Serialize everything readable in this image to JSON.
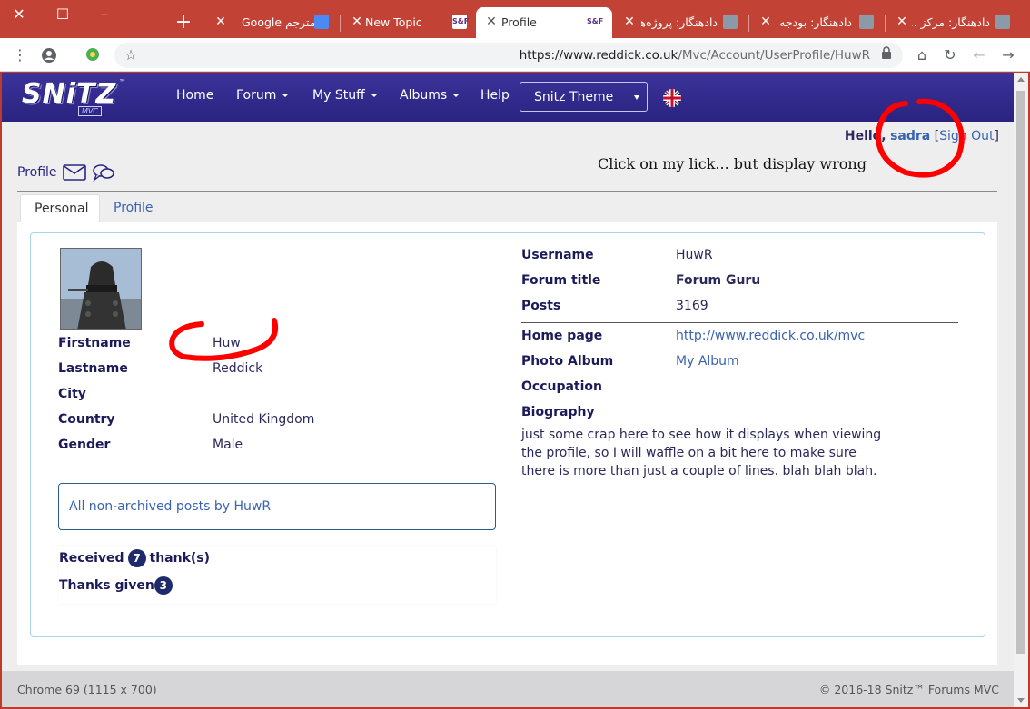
{
  "browser": {
    "tabs": [
      {
        "title": "دادهنگار: مرکز ...",
        "favicon": "snitz-favicon"
      },
      {
        "title": "دادهنگار: بودجه و...",
        "favicon": "snitz-favicon"
      },
      {
        "title": "دادهنگار: پروژه‌ها",
        "favicon": "snitz-favicon"
      },
      {
        "title": "Profile",
        "favicon": "snf-favicon"
      },
      {
        "title": "New Topic",
        "favicon": "snf-favicon"
      },
      {
        "title": "Google مترجم",
        "favicon": "google-translate-icon"
      }
    ],
    "url": {
      "host": "https://www.reddick.co.uk",
      "path": "/Mvc/Account/UserProfile/HuwR"
    }
  },
  "nav": {
    "logo_text": "SNiTZ",
    "logo_sub": "MVC",
    "logo_tm": "™",
    "home": "Home",
    "forum": "Forum",
    "my_stuff": "My Stuff",
    "albums": "Albums",
    "help": "Help",
    "theme": "Snitz Theme"
  },
  "greeting": {
    "hello": "Hello,",
    "user": "sadra",
    "sign_out": "Sign Out"
  },
  "page": {
    "profile_link": "Profile",
    "note": "Click on my lick... but display wrong",
    "tabs": {
      "personal": "Personal",
      "profile": "Profile"
    }
  },
  "personal": {
    "firstname_label": "Firstname",
    "firstname": "Huw",
    "lastname_label": "Lastname",
    "lastname": "Reddick",
    "city_label": "City",
    "city": "",
    "country_label": "Country",
    "country": "United Kingdom",
    "gender_label": "Gender",
    "gender": "Male",
    "posts_link": "All non-archived posts by HuwR",
    "received_label": "Received",
    "received_count": "7",
    "received_suffix": "thank(s)",
    "given_label": "Thanks given",
    "given_count": "3"
  },
  "account": {
    "username_label": "Username",
    "username": "HuwR",
    "forum_title_label": "Forum title",
    "forum_title": "Forum Guru",
    "posts_label": "Posts",
    "posts": "3169",
    "homepage_label": "Home page",
    "homepage": "http://www.reddick.co.uk/mvc",
    "album_label": "Photo Album",
    "album": "My Album",
    "occupation_label": "Occupation",
    "biography_label": "Biography",
    "biography": "just some crap here to see how it displays when viewing the profile, so I will waffle on a bit here to make sure there is more than just a couple of lines. blah blah blah."
  },
  "footer": {
    "left": "Chrome 69 (1115 x 700)",
    "right": "© 2016-18 Snitz™ Forums MVC"
  },
  "colors": {
    "nav": "#2a2380",
    "link": "#3a63b0",
    "label": "#1b1b5a",
    "annotation": "#ff0000",
    "tabstrip": "#c24335"
  }
}
